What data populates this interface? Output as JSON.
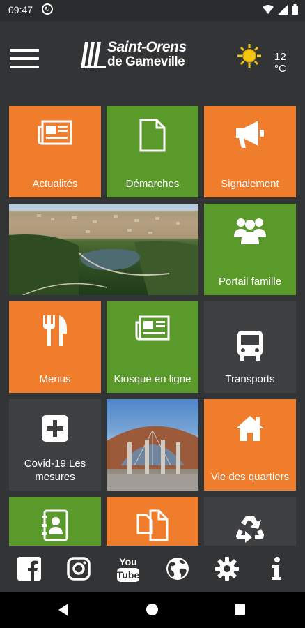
{
  "status_bar": {
    "time": "09:47"
  },
  "header": {
    "logo_line1": "Saint-Orens",
    "logo_line2": "de Gameville",
    "temperature": "12 °C",
    "weather_icon": "sun-icon"
  },
  "tiles": [
    {
      "label": "Actualités",
      "icon": "newspaper-icon",
      "color": "#ef7d2c"
    },
    {
      "label": "Démarches",
      "icon": "document-icon",
      "color": "#5a9a2b"
    },
    {
      "label": "Signalement",
      "icon": "megaphone-icon",
      "color": "#ef7d2c"
    },
    {
      "label": "Portail famille",
      "icon": "family-icon",
      "color": "#5a9a2b"
    },
    {
      "label": "Menus",
      "icon": "fork-knife-icon",
      "color": "#ef7d2c"
    },
    {
      "label": "Kiosque en ligne",
      "icon": "newspaper-icon",
      "color": "#5a9a2b"
    },
    {
      "label": "Transports",
      "icon": "bus-icon",
      "color": "#3f4042"
    },
    {
      "label": "Covid-19 Les mesures",
      "icon": "plus-icon",
      "color": "#3f4042"
    },
    {
      "label": "Vie des quartiers",
      "icon": "house-icon",
      "color": "#ef7d2c"
    },
    {
      "label": "",
      "icon": "contacts-icon",
      "color": "#5a9a2b"
    },
    {
      "label": "",
      "icon": "documents-icon",
      "color": "#ef7d2c"
    },
    {
      "label": "",
      "icon": "recycle-icon",
      "color": "#3f4042"
    }
  ],
  "bottom_nav": [
    "facebook-icon",
    "instagram-icon",
    "youtube-icon",
    "globe-icon",
    "settings-icon",
    "info-icon"
  ],
  "youtube": {
    "line1": "You",
    "line2": "Tube"
  },
  "info_glyph": "i"
}
